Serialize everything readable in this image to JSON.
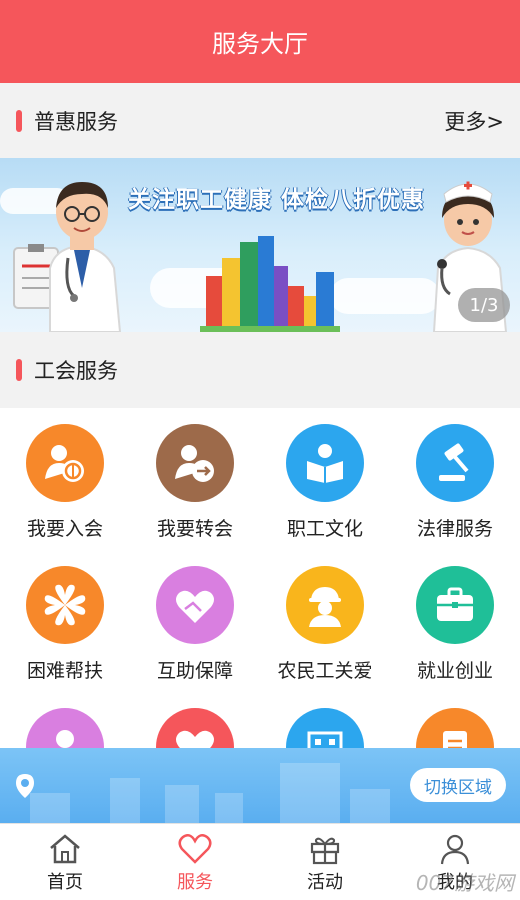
{
  "header": {
    "title": "服务大厅"
  },
  "puhui": {
    "title": "普惠服务",
    "more": "更多>"
  },
  "banner": {
    "slogan": "关注职工健康 体检八折优惠",
    "pager": "1/3"
  },
  "union": {
    "title": "工会服务"
  },
  "services": [
    {
      "label": "我要入会",
      "color": "#f7882a",
      "icon": "join-union-icon"
    },
    {
      "label": "我要转会",
      "color": "#9d6a4a",
      "icon": "transfer-union-icon"
    },
    {
      "label": "职工文化",
      "color": "#2ca6ee",
      "icon": "reading-icon"
    },
    {
      "label": "法律服务",
      "color": "#2ca6ee",
      "icon": "gavel-icon"
    },
    {
      "label": "困难帮扶",
      "color": "#f7882a",
      "icon": "clover-icon"
    },
    {
      "label": "互助保障",
      "color": "#d97fe0",
      "icon": "heart-hands-icon"
    },
    {
      "label": "农民工关爱",
      "color": "#f9b51c",
      "icon": "worker-icon"
    },
    {
      "label": "就业创业",
      "color": "#1fbf98",
      "icon": "briefcase-icon"
    },
    {
      "label": "",
      "color": "#d97fe0",
      "icon": "woman-icon"
    },
    {
      "label": "",
      "color": "#f5565b",
      "icon": "heart-icon"
    },
    {
      "label": "",
      "color": "#2ca6ee",
      "icon": "building-icon"
    },
    {
      "label": "",
      "color": "#f7882a",
      "icon": "document-icon"
    }
  ],
  "region": {
    "button": "切换区域"
  },
  "tabs": [
    {
      "label": "首页",
      "icon": "home-icon"
    },
    {
      "label": "服务",
      "icon": "heart-outline-icon"
    },
    {
      "label": "活动",
      "icon": "gift-icon"
    },
    {
      "label": "我的",
      "icon": "user-icon"
    }
  ],
  "watermark": "007游戏网"
}
